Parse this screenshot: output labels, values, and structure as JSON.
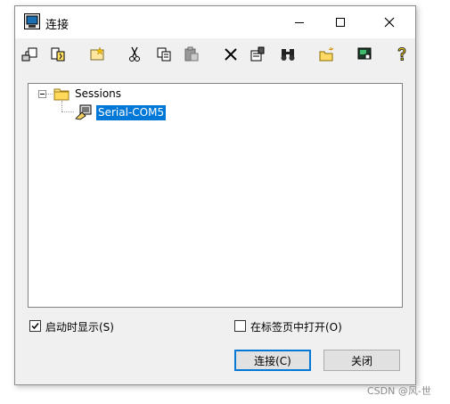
{
  "window": {
    "title": "连接"
  },
  "tree": {
    "root_label": "Sessions",
    "child_label": "Serial-COM5"
  },
  "options": {
    "show_on_startup_label": "启动时显示(S)",
    "show_on_startup_checked": true,
    "open_in_tab_label": "在标签页中打开(O)",
    "open_in_tab_checked": false
  },
  "buttons": {
    "connect": "连接(C)",
    "close": "关闭"
  },
  "watermark": "CSDN @风-世",
  "colors": {
    "selection": "#0078d7",
    "dialog_bg": "#f0f0f0"
  },
  "toolbar_icons": [
    "connect-icon",
    "quick-connect-icon",
    "new-session-icon",
    "cut-icon",
    "copy-icon",
    "paste-icon",
    "delete-icon",
    "properties-icon",
    "find-icon",
    "new-folder-icon",
    "desktop-shortcut-icon",
    "help-icon"
  ]
}
